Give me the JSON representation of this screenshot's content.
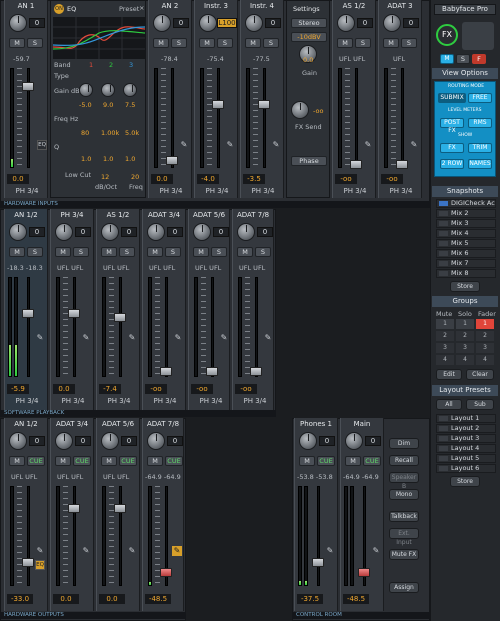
{
  "inputs": {
    "channels": [
      {
        "name": "AN 1",
        "gain": "-59.7",
        "bottom": "0.0",
        "route": "PH 3/4",
        "eq_label": "EQ"
      },
      {
        "name": "AN 2",
        "gain": "-78.4",
        "bottom": "0.0",
        "route": "PH 3/4"
      },
      {
        "name": "Instr. 3",
        "gain": "-75.4",
        "bottom": "-4.0",
        "route": "PH 3/4",
        "knob_value": "L100"
      },
      {
        "name": "Instr. 4",
        "gain": "-77.5",
        "bottom": "-3.5",
        "route": "PH 3/4"
      },
      {
        "name": "AS 1/2",
        "gain": "UFL   UFL",
        "bottom": "-oo",
        "route": "PH 3/4"
      },
      {
        "name": "ADAT 3",
        "gain": "UFL",
        "bottom": "-oo",
        "route": "PH 3/4"
      }
    ],
    "eq": {
      "on_label": "ON",
      "title": "EQ",
      "preset": "Preset",
      "band_label": "Band",
      "bands": [
        "1",
        "2",
        "3"
      ],
      "type_label": "Type",
      "gain_label": "Gain dB",
      "gain_values": [
        "-5.0",
        "9.0",
        "7.5"
      ],
      "freq_label": "Freq Hz",
      "freq_values": [
        "80",
        "1.00k",
        "5.0k"
      ],
      "q_label": "Q",
      "q_values": [
        "1.0",
        "1.0",
        "1.0"
      ],
      "lowcut_label": "Low Cut",
      "lowcut_value": "12",
      "lowcut_unit": "dB/Oct",
      "lowcut_freq": "20",
      "lowcut_freq_unit": "Freq"
    },
    "settings": {
      "title": "Settings",
      "stereo": "Stereo",
      "level": "-10dBV",
      "gain_value": "0.0",
      "gain_label": "Gain",
      "fxsend_value": "-oo",
      "fxsend_label": "FX Send",
      "phase": "Phase"
    },
    "section_label": "HARDWARE INPUTS"
  },
  "playback": {
    "channels": [
      {
        "name": "AN 1/2",
        "gain": "-18.3  -18.3",
        "bottom": "-5.9",
        "route": "PH 3/4"
      },
      {
        "name": "PH 3/4",
        "gain": "UFL   UFL",
        "bottom": "0.0",
        "route": "PH 3/4"
      },
      {
        "name": "AS 1/2",
        "gain": "UFL   UFL",
        "bottom": "-7.4",
        "route": "PH 3/4"
      },
      {
        "name": "ADAT 3/4",
        "gain": "UFL   UFL",
        "bottom": "-oo",
        "route": "PH 3/4"
      },
      {
        "name": "ADAT 5/6",
        "gain": "UFL   UFL",
        "bottom": "-oo",
        "route": "PH 3/4"
      },
      {
        "name": "ADAT 7/8",
        "gain": "UFL   UFL",
        "bottom": "-oo",
        "route": "PH 3/4"
      }
    ],
    "section_label": "SOFTWARE PLAYBACK"
  },
  "outputs": {
    "channels": [
      {
        "name": "AN 1/2",
        "gain": "UFL   UFL",
        "bottom": "-33.0"
      },
      {
        "name": "ADAT 3/4",
        "gain": "UFL   UFL",
        "bottom": "0.0"
      },
      {
        "name": "ADAT 5/6",
        "gain": "UFL   UFL",
        "bottom": "0.0"
      },
      {
        "name": "ADAT 7/8",
        "gain": "-64.9  -64.9",
        "bottom": "-48.5"
      }
    ],
    "section_label": "HARDWARE OUTPUTS",
    "eq_label": "EQ"
  },
  "control_room": {
    "channels": [
      {
        "name": "Phones 1",
        "gain": "-53.8  -53.8",
        "bottom": "-37.5"
      },
      {
        "name": "Main",
        "gain": "-64.9  -64.9",
        "bottom": "-48.5"
      }
    ],
    "buttons": [
      "Dim",
      "Recall",
      "Speaker B",
      "Mono",
      "Talkback",
      "Ext. Input",
      "Mute FX",
      "Assign"
    ],
    "section_label": "CONTROL ROOM"
  },
  "right_panel": {
    "device": "Babyface Pro",
    "fx_label": "FX",
    "msf": [
      "M",
      "S",
      "F"
    ],
    "view_options": "View Options",
    "routing_mode": "ROUTING MODE",
    "submix": "SUBMIX",
    "free": "FREE",
    "level_meters": "LEVEL METERS",
    "post_fx": "POST FX",
    "rms": "RMS",
    "show": "SHOW",
    "fx": "FX",
    "trim": "TRIM",
    "two_row": "2 ROW",
    "names": "NAMES",
    "snapshots": "Snapshots",
    "snapshot_items": [
      "DIGICheck Ac",
      "Mix 2",
      "Mix 3",
      "Mix 4",
      "Mix 5",
      "Mix 6",
      "Mix 7",
      "Mix 8"
    ],
    "store": "Store",
    "groups": "Groups",
    "group_headers": [
      "Mute",
      "Solo",
      "Fader"
    ],
    "group_rows": [
      [
        "1",
        "1",
        "1"
      ],
      [
        "2",
        "2",
        "2"
      ],
      [
        "3",
        "3",
        "3"
      ],
      [
        "4",
        "4",
        "4"
      ]
    ],
    "edit": "Edit",
    "clear": "Clear",
    "layout_presets": "Layout Presets",
    "all": "All",
    "sub": "Sub",
    "layout_items": [
      "Layout 1",
      "Layout 2",
      "Layout 3",
      "Layout 4",
      "Layout 5",
      "Layout 6"
    ],
    "layout_store": "Store"
  },
  "common": {
    "mute": "M",
    "solo": "S",
    "cue": "CUE",
    "zero": "0"
  }
}
